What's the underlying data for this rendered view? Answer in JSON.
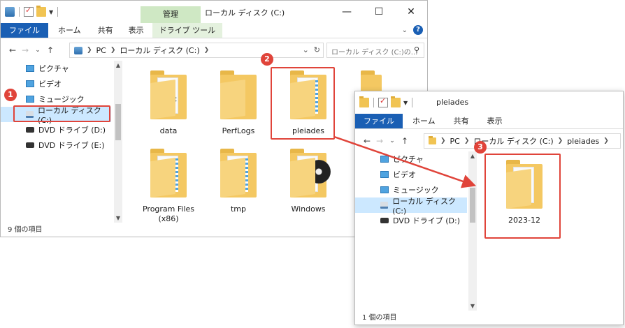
{
  "window1": {
    "title": "ローカル ディスク (C:)",
    "context_tab": "管理",
    "ribbon_tabs": [
      "ファイル",
      "ホーム",
      "共有",
      "表示",
      "ドライブ ツール"
    ],
    "breadcrumb": [
      "PC",
      "ローカル ディスク (C:)"
    ],
    "search_placeholder": "ローカル ディスク (C:)の...",
    "nav_items": [
      "ピクチャ",
      "ビデオ",
      "ミュージック",
      "ローカル ディスク (C:)",
      "DVD ドライブ (D:)",
      "DVD ドライブ (E:)"
    ],
    "items": [
      "data",
      "PerfLogs",
      "pleiades",
      "Program Files\n(x86)",
      "tmp",
      "Windows"
    ],
    "status": "9 個の項目"
  },
  "window2": {
    "title": "pleiades",
    "ribbon_tabs": [
      "ファイル",
      "ホーム",
      "共有",
      "表示"
    ],
    "breadcrumb": [
      "PC",
      "ローカル ディスク (C:)",
      "pleiades"
    ],
    "nav_items": [
      "ピクチャ",
      "ビデオ",
      "ミュージック",
      "ローカル ディスク (C:)",
      "DVD ドライブ (D:)"
    ],
    "items": [
      "2023-12"
    ],
    "status": "1 個の項目"
  },
  "annotations": {
    "step1": "1",
    "step2": "2",
    "step3": "3",
    "highlight_color": "#e0443a"
  },
  "icons": {
    "window_controls": [
      "minimize-icon",
      "maximize-icon",
      "close-icon"
    ],
    "help": "?"
  }
}
